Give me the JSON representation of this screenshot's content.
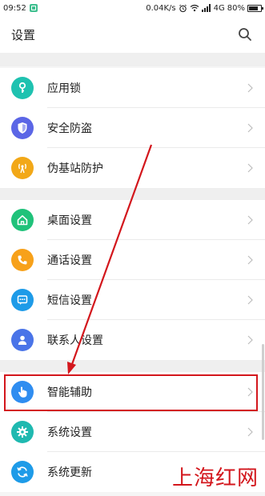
{
  "status_bar": {
    "time": "09:52",
    "speed": "0.04K/s",
    "network": "4G",
    "battery": "80%",
    "battery_level": 0.8
  },
  "header": {
    "title": "设置"
  },
  "groups": [
    {
      "items": [
        {
          "label": "应用锁",
          "color": "#1fc2b0",
          "icon": "key-icon"
        },
        {
          "label": "安全防盗",
          "color": "#5b66e6",
          "icon": "shield-icon"
        },
        {
          "label": "伪基站防护",
          "color": "#f2a818",
          "icon": "broadcast-icon"
        }
      ]
    },
    {
      "items": [
        {
          "label": "桌面设置",
          "color": "#20c27a",
          "icon": "home-icon"
        },
        {
          "label": "通话设置",
          "color": "#f7a11a",
          "icon": "phone-icon"
        },
        {
          "label": "短信设置",
          "color": "#1e9be8",
          "icon": "message-icon"
        },
        {
          "label": "联系人设置",
          "color": "#4a74e8",
          "icon": "person-icon"
        }
      ]
    },
    {
      "items": [
        {
          "label": "智能辅助",
          "color": "#2f8df0",
          "icon": "hand-icon"
        },
        {
          "label": "系统设置",
          "color": "#1fb9b0",
          "icon": "gear-icon"
        },
        {
          "label": "系统更新",
          "color": "#1e9be8",
          "icon": "refresh-icon"
        }
      ]
    }
  ],
  "watermark": "上海红网",
  "colors": {
    "highlight": "#d3161c"
  }
}
